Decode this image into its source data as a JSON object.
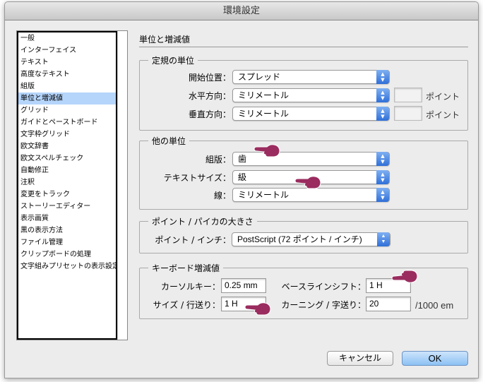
{
  "window": {
    "title": "環境設定"
  },
  "sidebar": {
    "items": [
      {
        "label": "一般"
      },
      {
        "label": "インターフェイス"
      },
      {
        "label": "テキスト"
      },
      {
        "label": "高度なテキスト"
      },
      {
        "label": "組版"
      },
      {
        "label": "単位と増減値",
        "selected": true
      },
      {
        "label": "グリッド"
      },
      {
        "label": "ガイドとペーストボード"
      },
      {
        "label": "文字枠グリッド"
      },
      {
        "label": "欧文辞書"
      },
      {
        "label": "欧文スペルチェック"
      },
      {
        "label": "自動修正"
      },
      {
        "label": "注釈"
      },
      {
        "label": "変更をトラック"
      },
      {
        "label": "ストーリーエディター"
      },
      {
        "label": "表示画質"
      },
      {
        "label": "黒の表示方法"
      },
      {
        "label": "ファイル管理"
      },
      {
        "label": "クリップボードの処理"
      },
      {
        "label": "文字組みプリセットの表示設定"
      }
    ]
  },
  "main": {
    "title": "単位と増減値",
    "ruler_units": {
      "label": "定規の単位",
      "origin": {
        "label": "開始位置：",
        "value": "スプレッド"
      },
      "horizontal": {
        "label": "水平方向：",
        "value": "ミリメートル",
        "points_unit": "ポイント"
      },
      "vertical": {
        "label": "垂直方向：",
        "value": "ミリメートル",
        "points_unit": "ポイント"
      }
    },
    "other_units": {
      "label": "他の単位",
      "composition": {
        "label": "組版：",
        "value": "歯"
      },
      "text_size": {
        "label": "テキストサイズ：",
        "value": "級"
      },
      "stroke": {
        "label": "線：",
        "value": "ミリメートル"
      }
    },
    "point_pica": {
      "label": "ポイント / パイカの大きさ",
      "points_inch": {
        "label": "ポイント / インチ：",
        "value": "PostScript (72 ポイント / インチ)"
      }
    },
    "keyboard": {
      "label": "キーボード増減値",
      "cursor_key": {
        "label": "カーソルキー：",
        "value": "0.25 mm"
      },
      "size_leading": {
        "label": "サイズ / 行送り：",
        "value": "1 H"
      },
      "baseline_shift": {
        "label": "ベースラインシフト：",
        "value": "1 H"
      },
      "kerning": {
        "label": "カーニング / 字送り：",
        "value": "20",
        "unit": "/1000 em"
      }
    }
  },
  "buttons": {
    "cancel": "キャンセル",
    "ok": "OK"
  },
  "colors": {
    "pointer_hand": "#9a2c5f",
    "selection": "#b5d5fb"
  },
  "icons": {
    "annotation": "pointing-hand-icon"
  }
}
